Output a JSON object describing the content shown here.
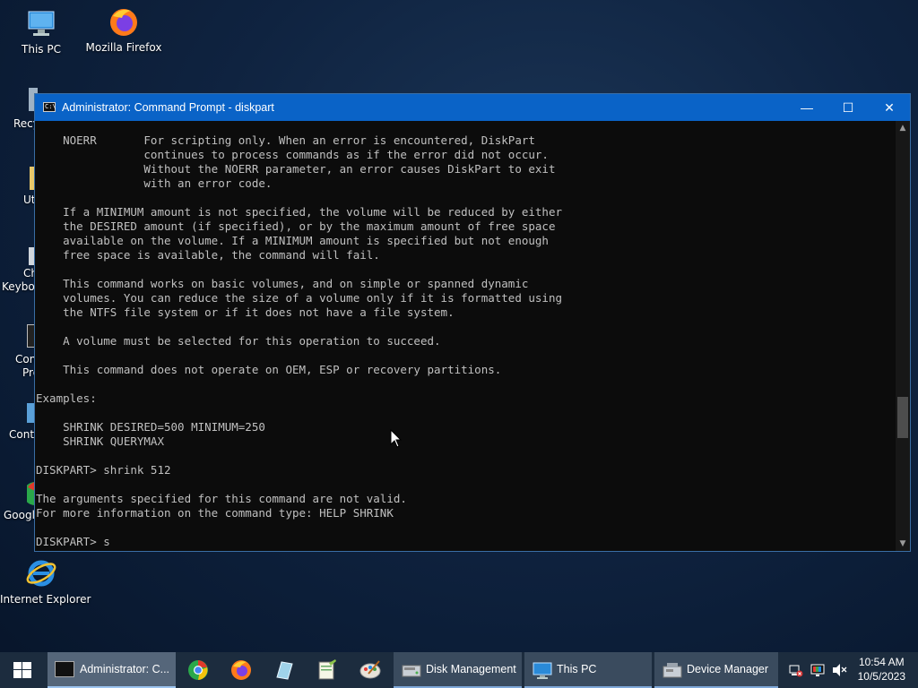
{
  "desktop": {
    "icons": [
      {
        "label": "This PC",
        "icon": "this-pc-icon"
      },
      {
        "label": "Mozilla Firefox",
        "icon": "firefox-icon"
      },
      {
        "label": "Recy",
        "icon": "recycle-bin-icon"
      },
      {
        "label": "Ut",
        "icon": "utilities-icon"
      },
      {
        "label": "Ch",
        "label2": "Keyboa",
        "icon": "keyboard-icon"
      },
      {
        "label": "Con",
        "label2": "Pro",
        "icon": "command-prompt-icon"
      },
      {
        "label": "Contr",
        "icon": "control-panel-icon"
      },
      {
        "label": "Google",
        "icon": "chrome-icon"
      },
      {
        "label": "Internet Explorer",
        "icon": "internet-explorer-icon"
      }
    ]
  },
  "window": {
    "title": "Administrator: Command Prompt - diskpart",
    "minimize": "—",
    "maximize": "☐",
    "close": "✕",
    "lines": [
      "    NOERR       For scripting only. When an error is encountered, DiskPart",
      "                continues to process commands as if the error did not occur.",
      "                Without the NOERR parameter, an error causes DiskPart to exit",
      "                with an error code.",
      "",
      "    If a MINIMUM amount is not specified, the volume will be reduced by either",
      "    the DESIRED amount (if specified), or by the maximum amount of free space",
      "    available on the volume. If a MINIMUM amount is specified but not enough",
      "    free space is available, the command will fail.",
      "",
      "    This command works on basic volumes, and on simple or spanned dynamic",
      "    volumes. You can reduce the size of a volume only if it is formatted using",
      "    the NTFS file system or if it does not have a file system.",
      "",
      "    A volume must be selected for this operation to succeed.",
      "",
      "    This command does not operate on OEM, ESP or recovery partitions.",
      "",
      "Examples:",
      "",
      "    SHRINK DESIRED=500 MINIMUM=250",
      "    SHRINK QUERYMAX",
      "",
      "DISKPART> shrink 512",
      "",
      "The arguments specified for this command are not valid.",
      "For more information on the command type: HELP SHRINK",
      "",
      "DISKPART> s"
    ]
  },
  "taskbar": {
    "start": "windows-start-icon",
    "buttons": [
      {
        "label": "Administrator: C...",
        "icon": "command-prompt-icon",
        "state": "active"
      },
      {
        "label": "",
        "icon": "chrome-icon"
      },
      {
        "label": "",
        "icon": "firefox-icon"
      },
      {
        "label": "",
        "icon": "notepad-icon"
      },
      {
        "label": "",
        "icon": "notepad-plus-plus-icon"
      },
      {
        "label": "",
        "icon": "paint-icon"
      },
      {
        "label": "Disk Management",
        "icon": "disk-management-icon"
      },
      {
        "label": "This PC",
        "icon": "this-pc-icon"
      },
      {
        "label": "Device Manager",
        "icon": "device-manager-icon"
      }
    ],
    "time": "10:54 AM",
    "date": "10/5/2023"
  }
}
